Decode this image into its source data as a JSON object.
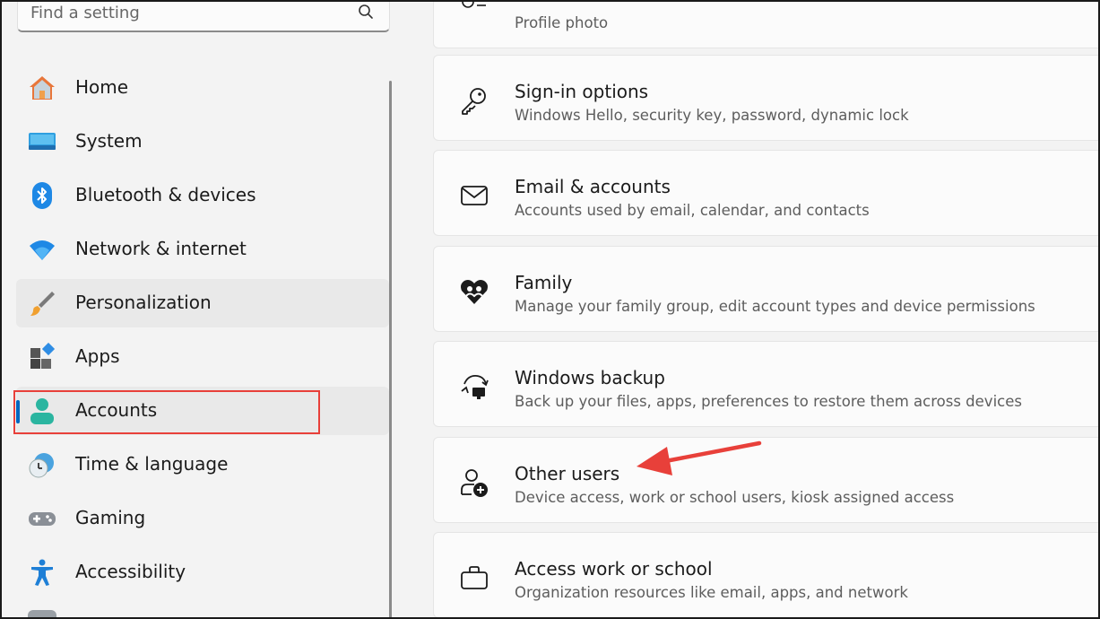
{
  "search": {
    "placeholder": "Find a setting"
  },
  "sidebar": {
    "items": [
      {
        "label": "Home",
        "icon": "home-icon"
      },
      {
        "label": "System",
        "icon": "system-icon"
      },
      {
        "label": "Bluetooth & devices",
        "icon": "bluetooth-icon"
      },
      {
        "label": "Network & internet",
        "icon": "wifi-icon"
      },
      {
        "label": "Personalization",
        "icon": "paintbrush-icon"
      },
      {
        "label": "Apps",
        "icon": "apps-icon"
      },
      {
        "label": "Accounts",
        "icon": "accounts-icon",
        "selected": true
      },
      {
        "label": "Time & language",
        "icon": "clock-globe-icon"
      },
      {
        "label": "Gaming",
        "icon": "gamepad-icon"
      },
      {
        "label": "Accessibility",
        "icon": "accessibility-icon"
      }
    ]
  },
  "main": {
    "cards": [
      {
        "title": "",
        "subtitle": "Profile photo",
        "icon": "profile-photo-icon"
      },
      {
        "title": "Sign-in options",
        "subtitle": "Windows Hello, security key, password, dynamic lock",
        "icon": "key-icon"
      },
      {
        "title": "Email & accounts",
        "subtitle": "Accounts used by email, calendar, and contacts",
        "icon": "mail-icon"
      },
      {
        "title": "Family",
        "subtitle": "Manage your family group, edit account types and device permissions",
        "icon": "family-heart-icon"
      },
      {
        "title": "Windows backup",
        "subtitle": "Back up your files, apps, preferences to restore them across devices",
        "icon": "backup-icon"
      },
      {
        "title": "Other users",
        "subtitle": "Device access, work or school users, kiosk assigned access",
        "icon": "add-user-icon"
      },
      {
        "title": "Access work or school",
        "subtitle": "Organization resources like email, apps, and network",
        "icon": "briefcase-icon"
      }
    ]
  },
  "colors": {
    "accent": "#0067c0",
    "annotation": "#e8403a"
  }
}
